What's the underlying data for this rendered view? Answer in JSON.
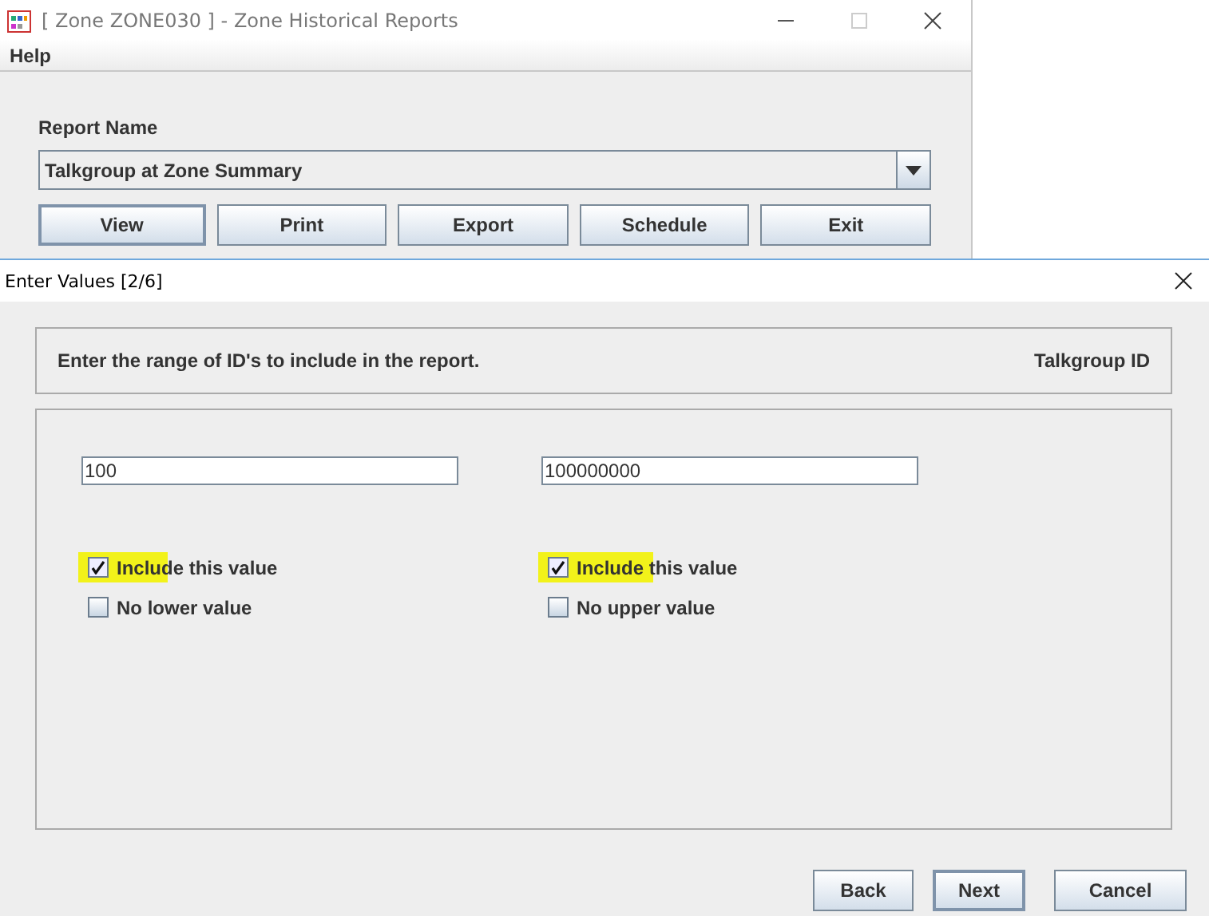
{
  "main_window": {
    "title": "[ Zone ZONE030 ] - Zone Historical Reports",
    "menu": [
      "Help"
    ],
    "report_label": "Report Name",
    "report_select": "Talkgroup at Zone Summary",
    "buttons": [
      {
        "label": "View",
        "selected": true
      },
      {
        "label": "Print",
        "selected": false
      },
      {
        "label": "Export",
        "selected": false
      },
      {
        "label": "Schedule",
        "selected": false
      },
      {
        "label": "Exit",
        "selected": false
      }
    ]
  },
  "dialog": {
    "title": "Enter Values [2/6]",
    "instruction": "Enter the range of ID's to include in the report.",
    "field_name": "Talkgroup ID",
    "columns": [
      {
        "value": "100",
        "options": [
          {
            "label": "Include this value",
            "checked": true,
            "highlighted": true
          },
          {
            "label": "No lower value",
            "checked": false,
            "highlighted": false
          }
        ]
      },
      {
        "value": "100000000",
        "options": [
          {
            "label": "Include this value",
            "checked": true,
            "highlighted": true
          },
          {
            "label": "No upper value",
            "checked": false,
            "highlighted": false
          }
        ]
      }
    ],
    "buttons": [
      {
        "label": "Back",
        "selected": false
      },
      {
        "label": "Next",
        "selected": true
      },
      {
        "label": "Cancel",
        "selected": false
      }
    ]
  }
}
